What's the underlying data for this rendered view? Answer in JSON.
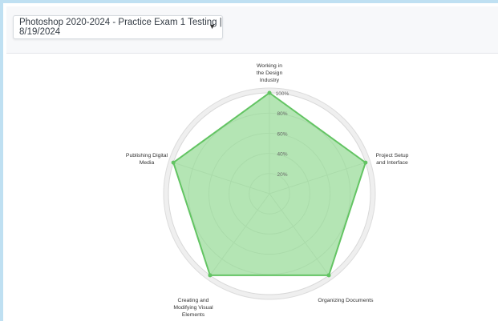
{
  "exam_selector": {
    "value": "Photoshop 2020-2024 - Practice Exam 1 Testing | 8/19/2024",
    "caret_icon": "caret-down-icon"
  },
  "chart_data": {
    "type": "radar",
    "categories": [
      [
        "Working in",
        "the Design",
        "Industry"
      ],
      [
        "Project Setup",
        "and Interface"
      ],
      [
        "Organizing Documents"
      ],
      [
        "Creating and",
        "Modifying Visual",
        "Elements"
      ],
      [
        "Publishing Digital",
        "Media"
      ]
    ],
    "series": [
      {
        "values": [
          100,
          100,
          100,
          100,
          100
        ]
      }
    ],
    "rlim": [
      0,
      100
    ],
    "ticks": [
      "20%",
      "40%",
      "60%",
      "80%",
      "100%"
    ],
    "tick_values": [
      20,
      40,
      60,
      80,
      100
    ],
    "colors": {
      "fill": "#9bdc9b",
      "stroke": "#63c463",
      "rings": "#d8d8d8",
      "outer_band": "#efefef"
    }
  }
}
